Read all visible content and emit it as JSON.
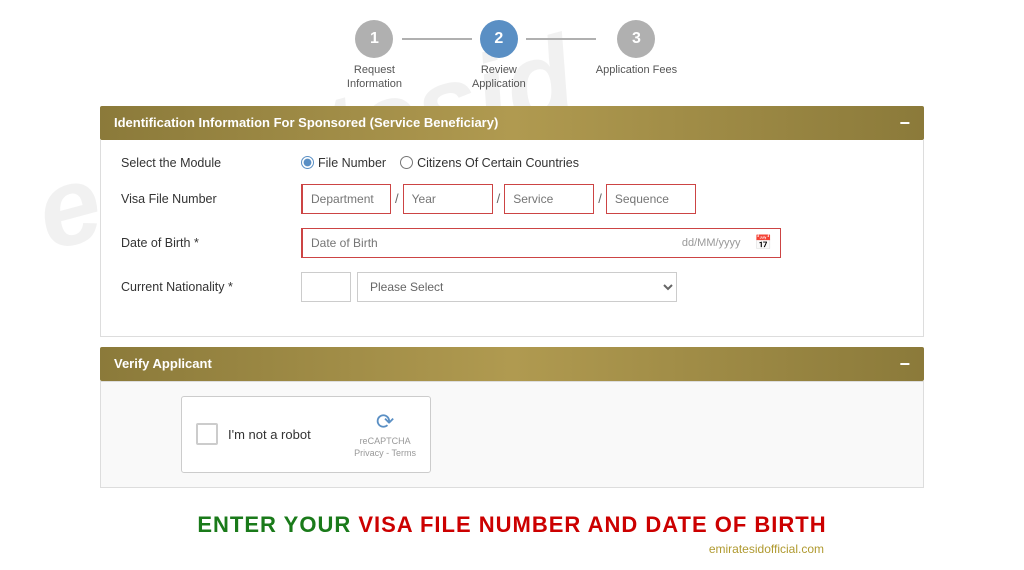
{
  "watermark": {
    "text": "emiratesid.com"
  },
  "steps": [
    {
      "number": "1",
      "label": "Request\nInformation",
      "active": false
    },
    {
      "number": "2",
      "label": "Review\nApplication",
      "active": true
    },
    {
      "number": "3",
      "label": "Application Fees",
      "active": false
    }
  ],
  "identification_section": {
    "title": "Identification Information For Sponsored (Service Beneficiary)",
    "collapse_icon": "−",
    "fields": {
      "module": {
        "label": "Select the Module",
        "options": [
          "File Number",
          "Citizens Of Certain Countries"
        ],
        "selected": "File Number"
      },
      "visa_file_number": {
        "label": "Visa File Number",
        "placeholders": {
          "department": "Department",
          "year": "Year",
          "service": "Service",
          "sequence": "Sequence"
        }
      },
      "date_of_birth": {
        "label": "Date of Birth *",
        "placeholder": "Date of Birth",
        "format_hint": "dd/MM/yyyy"
      },
      "current_nationality": {
        "label": "Current Nationality *",
        "code_placeholder": "",
        "select_placeholder": "Please Select"
      }
    }
  },
  "verify_section": {
    "title": "Verify Applicant",
    "collapse_icon": "−",
    "captcha": {
      "checkbox_label": "I'm not a robot",
      "brand": "reCAPTCHA",
      "privacy": "Privacy",
      "terms": "Terms"
    }
  },
  "bottom_banner": {
    "text_green_1": "ENTER YOUR ",
    "text_red": "VISA FILE NUMBER AND DATE OF BIRTH",
    "text_green_2": ""
  },
  "brand": {
    "website": "emiratesidofficial.com"
  }
}
